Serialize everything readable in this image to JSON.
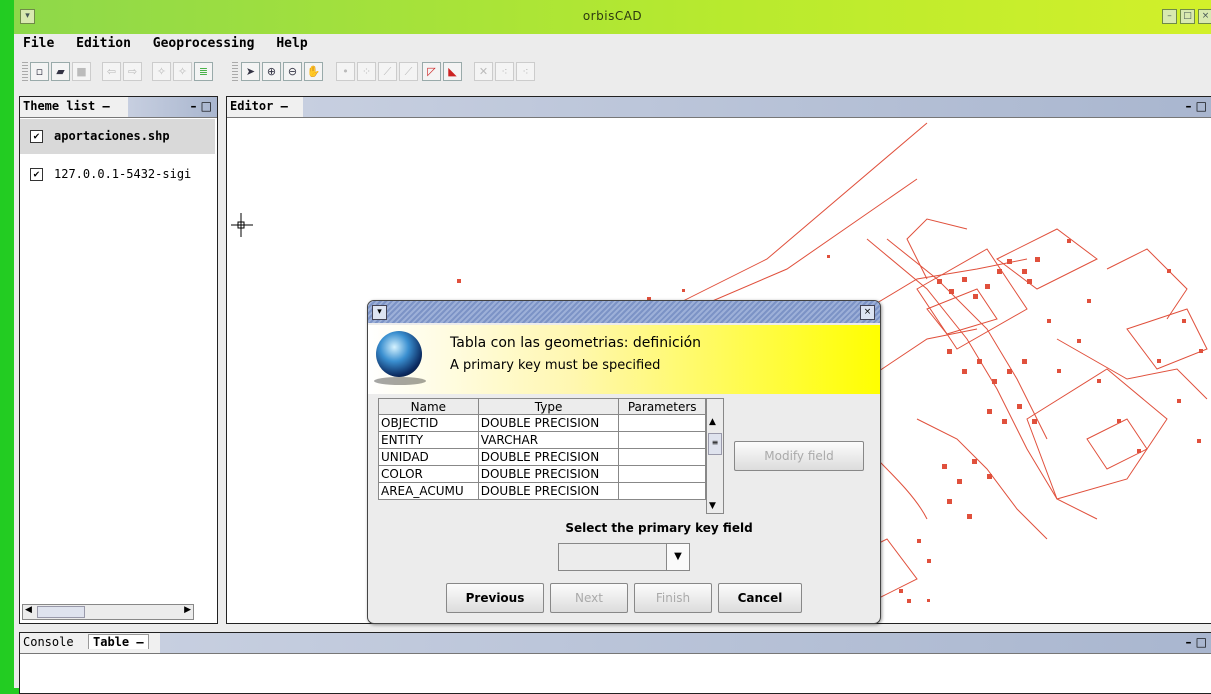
{
  "app": {
    "title": "orbisCAD"
  },
  "menu": [
    "File",
    "Edition",
    "Geoprocessing",
    "Help"
  ],
  "theme_panel": {
    "title": "Theme list",
    "items": [
      {
        "label": "aportaciones.shp",
        "checked": true,
        "selected": true
      },
      {
        "label": "127.0.0.1-5432-sigi",
        "checked": true,
        "selected": false
      }
    ]
  },
  "editor_panel": {
    "title": "Editor"
  },
  "bottom_panel": {
    "tabs": [
      "Console",
      "Table"
    ]
  },
  "dialog": {
    "heading": "Tabla con las geometrias: definición",
    "subheading": "A primary key must be specified",
    "columns": [
      "Name",
      "Type",
      "Parameters"
    ],
    "rows": [
      {
        "name": "OBJECTID",
        "type": "DOUBLE PRECISION",
        "params": ""
      },
      {
        "name": "ENTITY",
        "type": "VARCHAR",
        "params": ""
      },
      {
        "name": "UNIDAD",
        "type": "DOUBLE PRECISION",
        "params": ""
      },
      {
        "name": "COLOR",
        "type": "DOUBLE PRECISION",
        "params": ""
      },
      {
        "name": "AREA_ACUMU",
        "type": "DOUBLE PRECISION",
        "params": ""
      }
    ],
    "modify_label": "Modify field",
    "pk_label": "Select the primary key field",
    "pk_value": "",
    "buttons": {
      "previous": "Previous",
      "next": "Next",
      "finish": "Finish",
      "cancel": "Cancel"
    }
  },
  "colors": {
    "map_lines": "#e0503c",
    "title_green": "#b8ea2e",
    "dialog_yellow": "#ffff00"
  }
}
